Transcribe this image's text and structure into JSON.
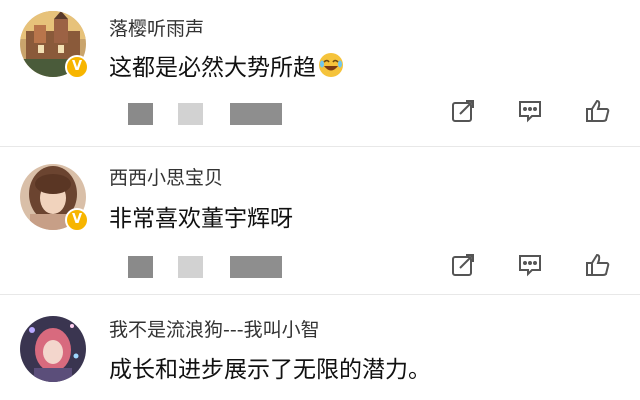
{
  "comments": [
    {
      "username": "落樱听雨声",
      "text": "这都是必然大势所趋",
      "emoji": "laughing-crying-emoji",
      "verified_mark": "V"
    },
    {
      "username": "西西小思宝贝",
      "text": "非常喜欢董宇辉呀",
      "verified_mark": "V"
    },
    {
      "username": "我不是流浪狗---我叫小智",
      "text": "成长和进步展示了无限的潜力。"
    }
  ],
  "icons": {
    "repost": "repost-icon",
    "comment": "comment-icon",
    "like": "thumbs-up-icon"
  },
  "colors": {
    "verified": "#f7b500",
    "username": "#333333",
    "text": "#111111",
    "icon": "#555555"
  }
}
